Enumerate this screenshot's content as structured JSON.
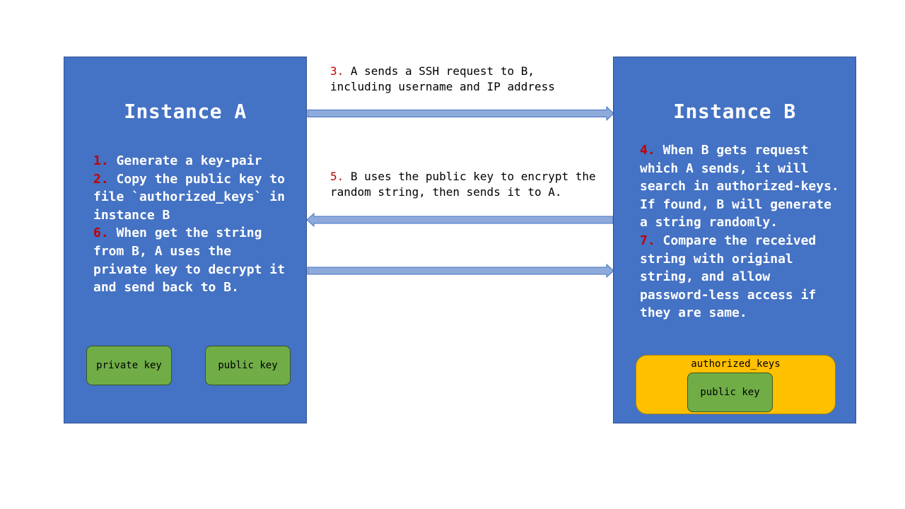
{
  "instance_a": {
    "title": "Instance A",
    "steps": [
      {
        "num": "1.",
        "text": " Generate a key-pair\n"
      },
      {
        "num": "2.",
        "text": " Copy the public key to file `authorized_keys` in instance B\n"
      },
      {
        "num": "6.",
        "text": " When get the string from B, A uses the private key to decrypt it and send back to B."
      }
    ],
    "keys": {
      "private": "private key",
      "public": "public key"
    }
  },
  "instance_b": {
    "title": "Instance B",
    "steps": [
      {
        "num": "4.",
        "text": " When B gets request which A sends, it will search in authorized-keys. If found, B will generate a string randomly.\n"
      },
      {
        "num": "7.",
        "text": " Compare the received string with original string, and allow password-less access if they are same."
      }
    ],
    "authorized_keys_label": "authorized_keys",
    "public_key_label": "public key"
  },
  "messages": {
    "msg3": {
      "num": "3.",
      "text": " A sends a SSH request to B, including username and IP address"
    },
    "msg5": {
      "num": "5.",
      "text": " B uses the public key to encrypt the random string, then sends it to A."
    }
  },
  "colors": {
    "box_fill": "#4472c4",
    "key_fill": "#70ad47",
    "authorized_fill": "#ffc000",
    "arrow_fill": "#8eaadb",
    "step_number": "#c00000"
  }
}
